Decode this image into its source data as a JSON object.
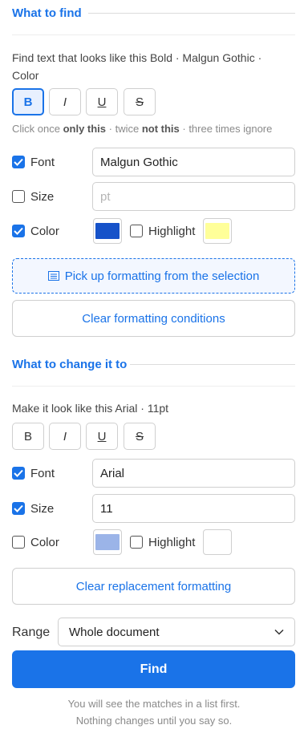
{
  "find_section": {
    "title": "What to find",
    "preview_label": "Find text that looks like this Bold · Malgun Gothic · Color",
    "format_buttons": [
      {
        "label": "B",
        "active": true
      },
      {
        "label": "I",
        "active": false
      },
      {
        "label": "U",
        "active": false
      },
      {
        "label": "S",
        "active": false
      }
    ],
    "toggle_hint": {
      "prefix": "Click once ",
      "once": "only this",
      "mid": " · twice ",
      "twice": "not this",
      "suffix": " · three times ignore"
    },
    "font": {
      "label": "Font",
      "checked": true,
      "value": "Malgun Gothic"
    },
    "size": {
      "label": "Size",
      "checked": false,
      "placeholder": "pt"
    },
    "color": {
      "label": "Color",
      "checked": true,
      "swatch": "#1652c9"
    },
    "highlight": {
      "label": "Highlight",
      "checked": false,
      "swatch": "#ffff99"
    },
    "pickup_label": "Pick up formatting from the selection",
    "clear_label": "Clear formatting conditions"
  },
  "replace_section": {
    "title": "What to change it to",
    "preview_label": "Make it look like this Arial · 11pt",
    "format_buttons": [
      {
        "label": "B",
        "active": false
      },
      {
        "label": "I",
        "active": false
      },
      {
        "label": "U",
        "active": false
      },
      {
        "label": "S",
        "active": false
      }
    ],
    "font": {
      "label": "Font",
      "checked": true,
      "value": "Arial"
    },
    "size": {
      "label": "Size",
      "checked": true,
      "value": "11"
    },
    "color": {
      "label": "Color",
      "checked": false,
      "swatch": "#9bb4e8"
    },
    "highlight": {
      "label": "Highlight",
      "checked": false,
      "swatch": "#ffffff"
    },
    "clear_label": "Clear replacement formatting"
  },
  "range": {
    "label": "Range",
    "selected": "Whole document"
  },
  "find_button_label": "Find",
  "footer_note": [
    "You will see the matches in a list first.",
    "Nothing changes until you say so."
  ],
  "colors": {
    "accent": "#1a73e8"
  }
}
